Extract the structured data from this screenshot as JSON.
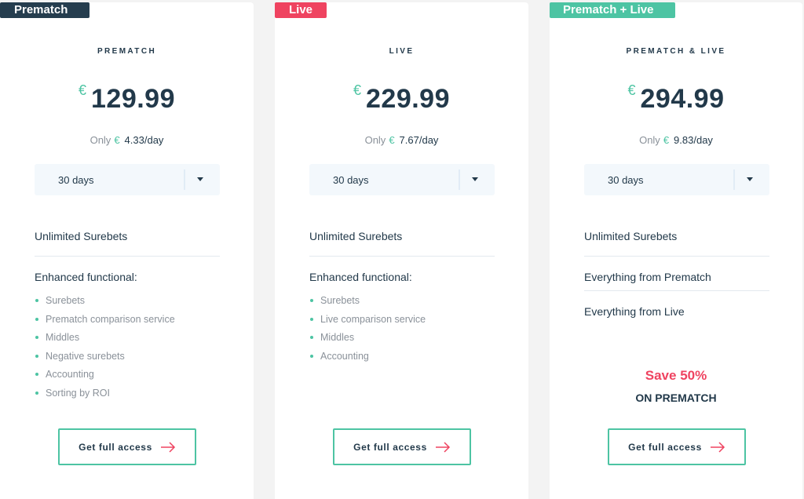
{
  "colors": {
    "accent_green": "#4dc4a3",
    "accent_red": "#ef4360",
    "dark": "#22394a"
  },
  "plans": [
    {
      "ribbon": "Prematch",
      "name": "PREMATCH",
      "currency": "€",
      "price": "129.99",
      "per_day_prefix": "Only",
      "per_day_value": "4.33/day",
      "duration": "30 days",
      "features": [
        "Unlimited Surebets",
        "Enhanced functional:"
      ],
      "bullets": [
        "Surebets",
        "Prematch comparison service",
        "Middles",
        "Negative surebets",
        "Accounting",
        "Sorting by ROI"
      ],
      "cta": "Get full access"
    },
    {
      "ribbon": "Live",
      "name": "LIVE",
      "currency": "€",
      "price": "229.99",
      "per_day_prefix": "Only",
      "per_day_value": "7.67/day",
      "duration": "30 days",
      "features": [
        "Unlimited Surebets",
        "Enhanced functional:"
      ],
      "bullets": [
        "Surebets",
        "Live comparison service",
        "Middles",
        "Accounting"
      ],
      "cta": "Get full access"
    },
    {
      "ribbon": "Prematch + Live",
      "name": "PREMATCH & LIVE",
      "currency": "€",
      "price": "294.99",
      "per_day_prefix": "Only",
      "per_day_value": "9.83/day",
      "duration": "30 days",
      "features": [
        "Unlimited Surebets",
        "Everything from Prematch",
        "Everything from Live"
      ],
      "save": "Save 50%",
      "save_sub": "ON PREMATCH",
      "cta": "Get full access"
    }
  ]
}
